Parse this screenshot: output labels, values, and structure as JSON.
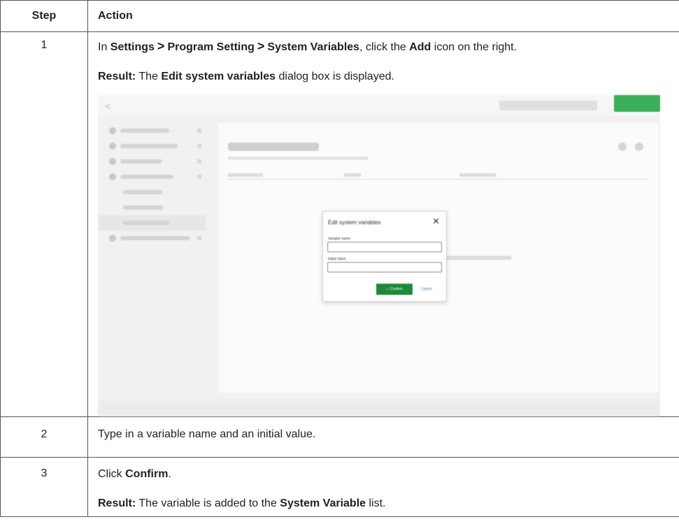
{
  "table": {
    "headers": {
      "step": "Step",
      "action": "Action"
    },
    "rows": [
      {
        "number": "1",
        "intro": "In ",
        "nav1": "Settings",
        "sep": ">",
        "nav2": "Program Setting",
        "nav3": "System Variables",
        "mid": ", click the ",
        "add": "Add",
        "tail": " icon on the right.",
        "result_label": "Result:",
        "result_pre": " The ",
        "result_bold": "Edit system variables",
        "result_post": " dialog box is displayed."
      },
      {
        "number": "2",
        "text": "Type in a variable name and an initial value."
      },
      {
        "number": "3",
        "pre": "Click ",
        "bold": "Confirm",
        "post": ".",
        "result_label": "Result:",
        "result_pre": " The variable is added to the ",
        "result_bold": "System Variable",
        "result_post": " list."
      }
    ]
  },
  "screenshot": {
    "back_glyph": "<",
    "dialog": {
      "title": "Edit system variables",
      "close_glyph": "✕",
      "field1_label": "Variable name",
      "field2_label": "Initial Value",
      "confirm_label": "✓  Confirm",
      "cancel_label": "Cancel"
    },
    "colors": {
      "confirm": "#1b8a3a",
      "save": "#3dae5a",
      "cancel_link": "#2a7ab8"
    }
  }
}
